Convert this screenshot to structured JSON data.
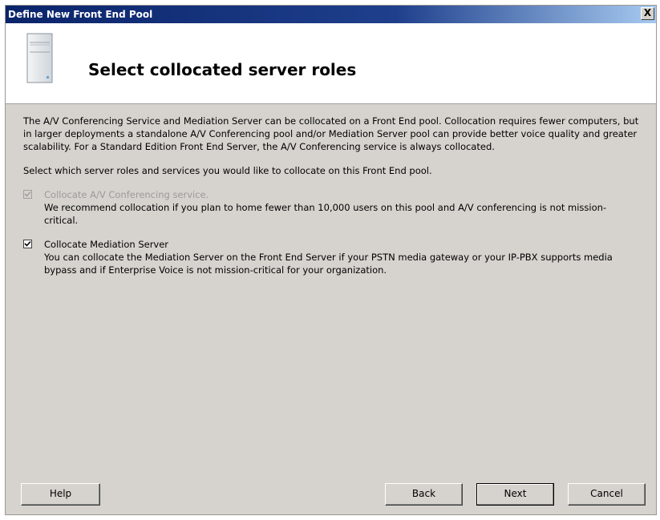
{
  "window": {
    "title": "Define New Front End Pool",
    "close_label": "X"
  },
  "header": {
    "title": "Select collocated server roles",
    "icon": "server-icon"
  },
  "content": {
    "intro": "The A/V Conferencing Service and Mediation Server can be collocated on a Front End pool. Collocation requires fewer computers, but in larger deployments a standalone A/V Conferencing pool and/or Mediation Server pool can provide better voice quality and greater scalability.  For a Standard Edition Front End Server, the A/V Conferencing service is always collocated.",
    "select_prompt": "Select which server roles and services you would like to collocate on this Front End pool.",
    "options": [
      {
        "label": "Collocate A/V Conferencing service.",
        "description": "We recommend collocation if you plan to home fewer than 10,000 users on this pool and A/V conferencing is not mission-critical.",
        "checked": true,
        "enabled": false
      },
      {
        "label": "Collocate Mediation Server",
        "description": "You can collocate the Mediation Server on the Front End Server if your PSTN media gateway or your IP-PBX supports media bypass and if Enterprise Voice is not mission-critical for your organization.",
        "checked": true,
        "enabled": true
      }
    ]
  },
  "buttons": {
    "help": "Help",
    "back": "Back",
    "next": "Next",
    "cancel": "Cancel"
  }
}
